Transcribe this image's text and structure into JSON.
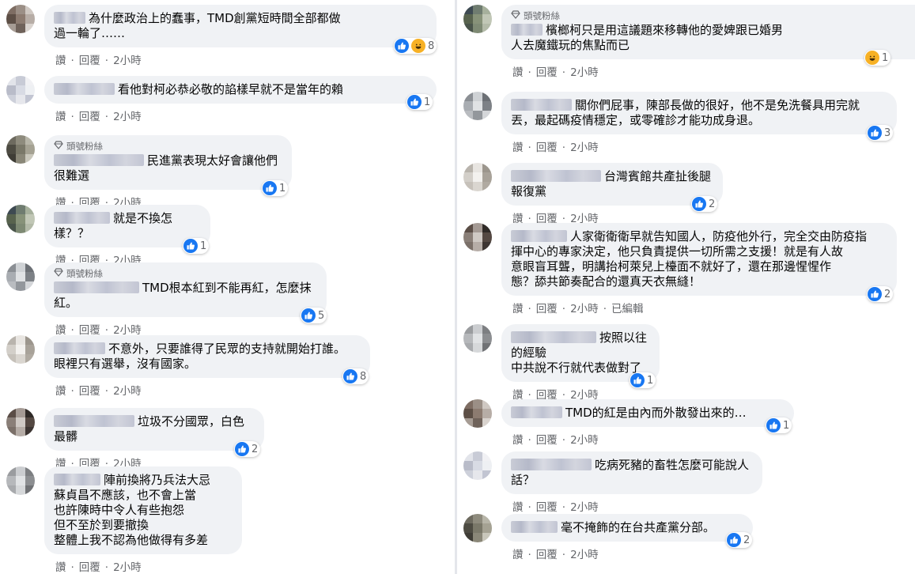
{
  "colors": {
    "bubble": "#f0f2f5",
    "like": "#1877f2",
    "haha": "#f7b125",
    "meta": "#65676b"
  },
  "actions": {
    "like": "讚",
    "reply": "回覆",
    "dot": "·"
  },
  "badge_label": "頭號粉絲",
  "left": [
    {
      "text": "為什麼政治上的蠢事，TMD創黨短時間全部都做\n過一輪了……",
      "time": "2小時",
      "reactions": [
        "like-icon",
        "haha-icon"
      ],
      "count": "8"
    },
    {
      "text": "看他對柯必恭必敬的諂樣早就不是當年的賴",
      "time": "2小時",
      "reactions": [
        "like-icon"
      ],
      "count": "1"
    },
    {
      "badge": true,
      "text": "民進黨表現太好會讓他們很難選",
      "time": "2小時",
      "reactions": [
        "like-icon"
      ],
      "count": "1"
    },
    {
      "text": "就是不換怎樣？？",
      "time": "2小時",
      "reactions": [
        "like-icon"
      ],
      "count": "1"
    },
    {
      "badge": true,
      "text": "TMD根本紅到不能再紅，怎麼抹紅。",
      "time": "2小時",
      "reactions": [
        "like-icon"
      ],
      "count": "5"
    },
    {
      "text": "不意外，只要誰得了民眾的支持就開始打誰。\n眼裡只有選舉，沒有國家。",
      "time": "2小時",
      "reactions": [
        "like-icon"
      ],
      "count": "8"
    },
    {
      "text": "垃圾不分國眾，白色最髒",
      "time": "2小時",
      "reactions": [
        "like-icon"
      ],
      "count": "2"
    },
    {
      "text": "陣前換將乃兵法大忌\n蘇貞昌不應該，也不會上當\n也許陳時中令人有些抱怨\n但不至於到要撤換\n整體上我不認為他做得有多差",
      "time": "2小時"
    }
  ],
  "right": [
    {
      "badge": true,
      "text": "檳榔柯只是用這議題來移轉他的愛婢跟已婚男\n人去魔鐵玩的焦點而已",
      "time": "2小時",
      "reactions": [
        "haha-icon"
      ],
      "count": "1"
    },
    {
      "text": "關你們屁事，陳部長做的很好，他不是免洗餐具用完就\n丟，最起碼疫情穩定，或零確診才能功成身退。",
      "time": "2小時",
      "reactions": [
        "like-icon"
      ],
      "count": "3"
    },
    {
      "text": "台灣賓館共產扯後腿報復黨",
      "time": "2小時",
      "reactions": [
        "like-icon"
      ],
      "count": "2"
    },
    {
      "text": "人家衛衛衛早就告知國人，防疫他外行，完全交由防疫指\n揮中心的專家決定，他只負責提供一切所需之支援！就是有人故\n意眼盲耳聾，明講抬柯萊兒上檯面不就好了，還在那邊惺惺作\n態？舔共節奏配合的還真天衣無縫！",
      "time": "2小時",
      "edited": "已編輯",
      "reactions": [
        "like-icon"
      ],
      "count": "2"
    },
    {
      "text": "按照以往的經驗\n中共說不行就代表做對了",
      "time": "2小時",
      "reactions": [
        "like-icon"
      ],
      "count": "1"
    },
    {
      "text": "TMD的紅是由內而外散發出來的…",
      "time": "2小時",
      "reactions": [
        "like-icon"
      ],
      "count": "1"
    },
    {
      "text": "吃病死豬的畜牲怎麼可能說人話？",
      "time": "2小時"
    },
    {
      "text": "毫不掩飾的在台共產黨分部。",
      "time": "2小時",
      "reactions": [
        "like-icon"
      ],
      "count": "2"
    }
  ]
}
